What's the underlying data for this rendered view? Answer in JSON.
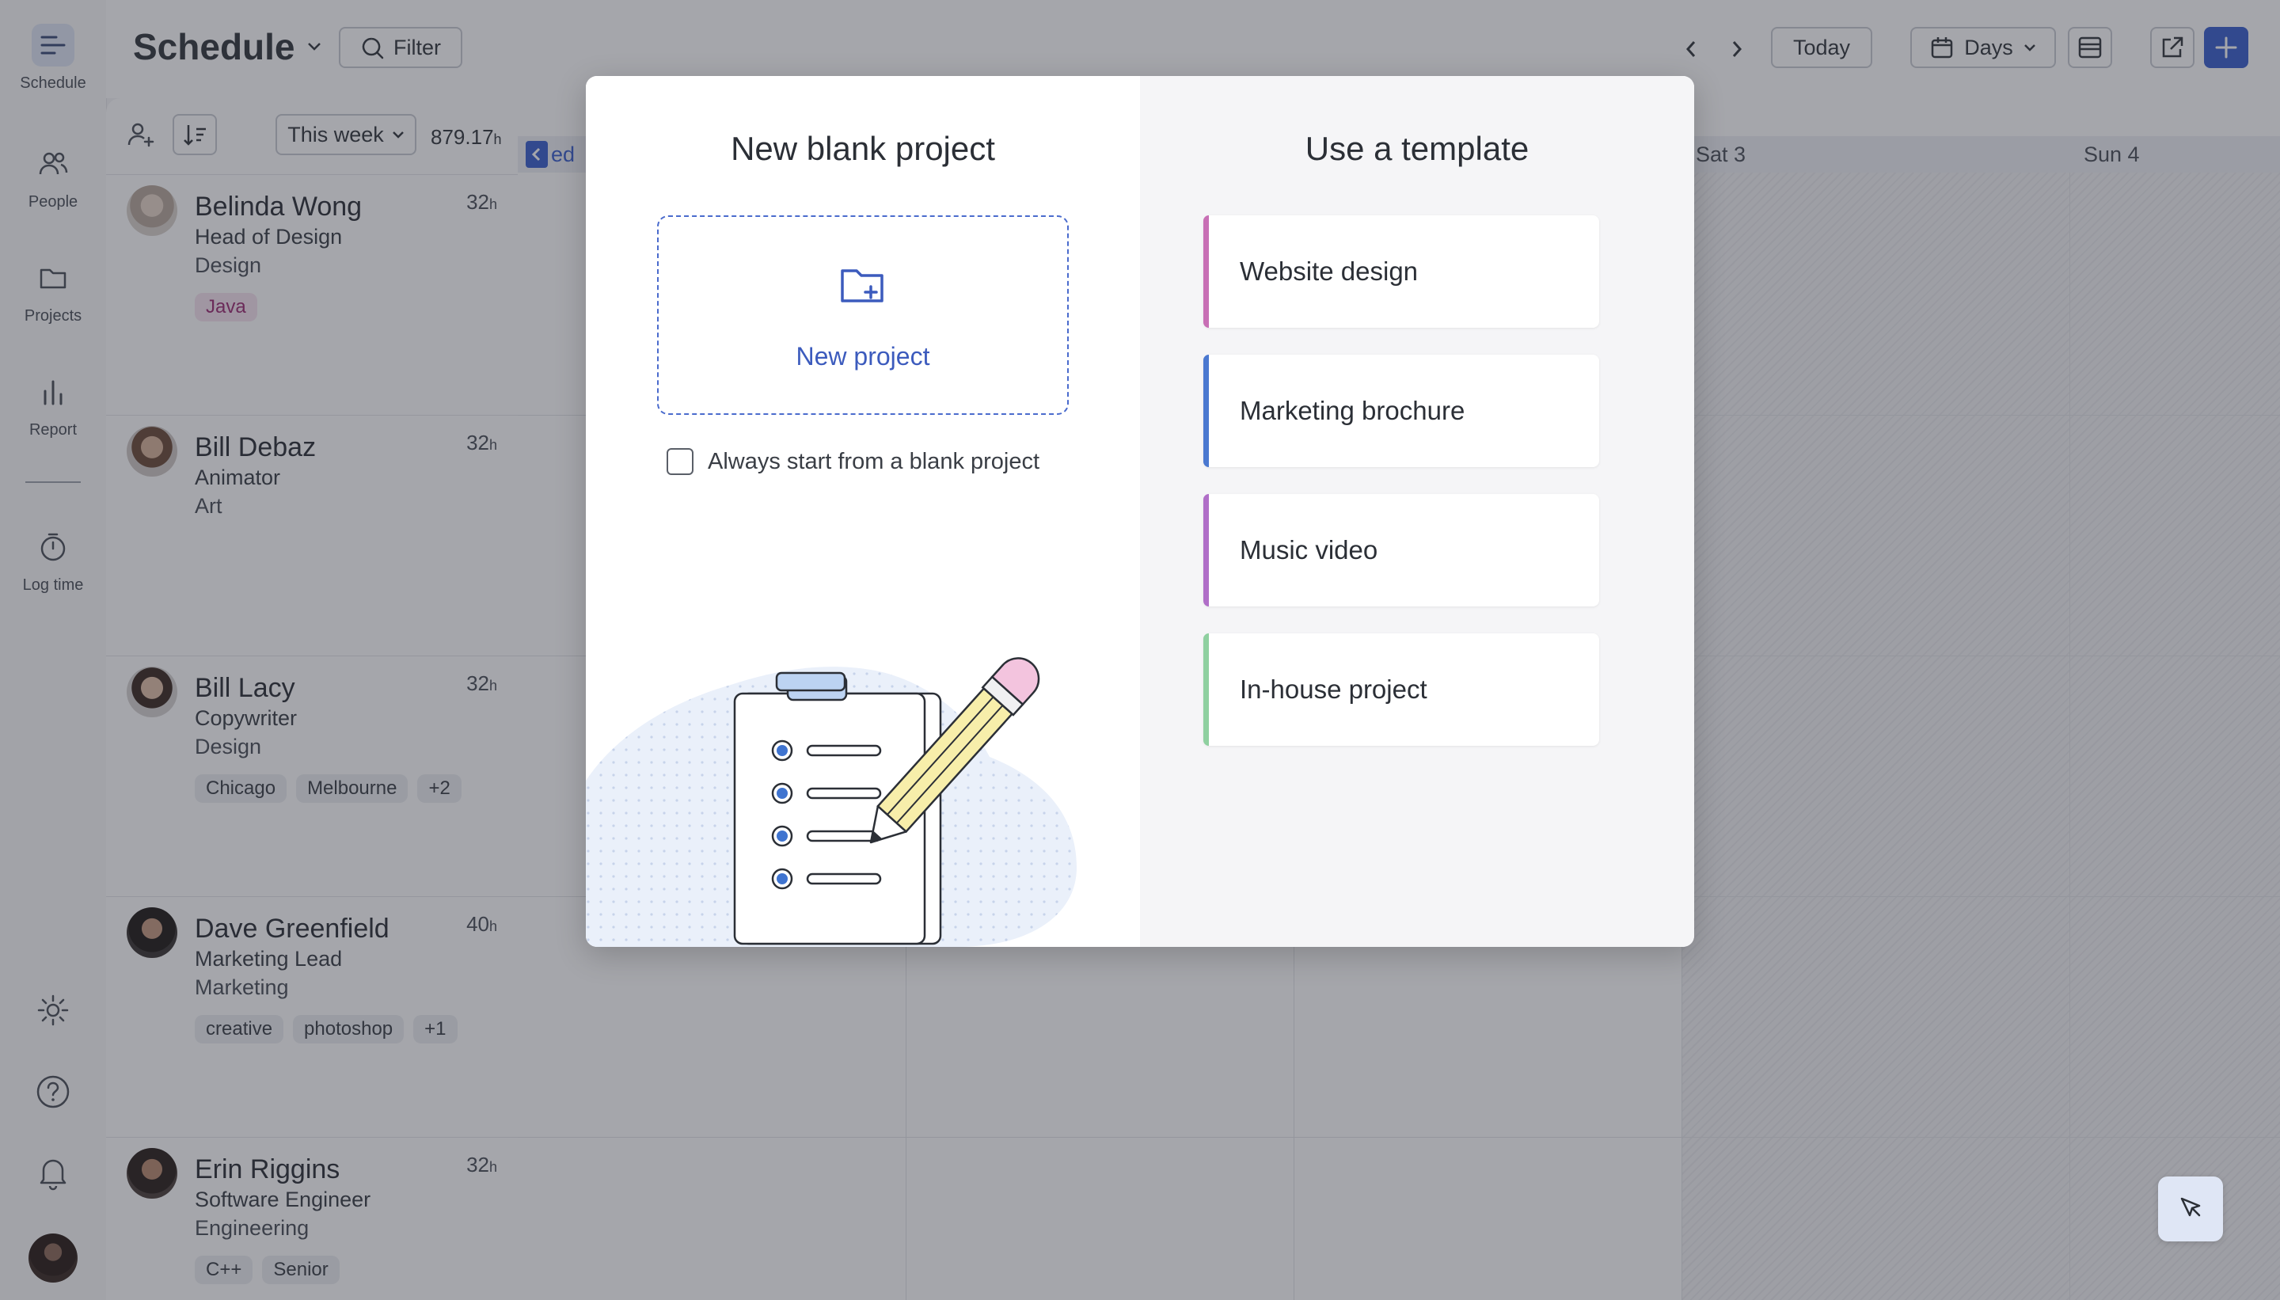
{
  "app": {
    "title": "Schedule",
    "filter_label": "Filter",
    "today_label": "Today",
    "view_label": "Days",
    "accent_color": "#3a5fcd"
  },
  "rail": {
    "items": [
      {
        "label": "Schedule",
        "icon": "schedule-icon"
      },
      {
        "label": "People",
        "icon": "people-icon"
      },
      {
        "label": "Projects",
        "icon": "folder-icon"
      },
      {
        "label": "Report",
        "icon": "bar-chart-icon"
      },
      {
        "label": "Log time",
        "icon": "timer-icon"
      }
    ]
  },
  "people_panel": {
    "range_label": "This week",
    "total_hours": "879.17",
    "hours_unit": "h"
  },
  "people": [
    {
      "name": "Belinda Wong",
      "role": "Head of Design",
      "dept": "Design",
      "hours": "32",
      "tags": [
        "Java"
      ]
    },
    {
      "name": "Bill Debaz",
      "role": "Animator",
      "dept": "Art",
      "hours": "32",
      "tags": []
    },
    {
      "name": "Bill Lacy",
      "role": "Copywriter",
      "dept": "Design",
      "hours": "32",
      "tags": [
        "Chicago",
        "Melbourne",
        "+2"
      ]
    },
    {
      "name": "Dave Greenfield",
      "role": "Marketing Lead",
      "dept": "Marketing",
      "hours": "40",
      "tags": [
        "creative",
        "photoshop",
        "+1"
      ]
    },
    {
      "name": "Erin Riggins",
      "role": "Software Engineer",
      "dept": "Engineering",
      "hours": "32",
      "tags": [
        "C++",
        "Senior"
      ]
    }
  ],
  "calendar": {
    "partial_day": "ed",
    "days": [
      "Sat 3",
      "Sun 4"
    ]
  },
  "modal": {
    "blank_title": "New blank project",
    "new_project_label": "New project",
    "always_blank_label": "Always start from a blank project",
    "always_blank_checked": false,
    "template_title": "Use a template",
    "templates": [
      {
        "label": "Website design",
        "color": "#c86fb5"
      },
      {
        "label": "Marketing brochure",
        "color": "#4a78d0"
      },
      {
        "label": "Music video",
        "color": "#b06ec8"
      },
      {
        "label": "In-house project",
        "color": "#8fd0a0"
      }
    ]
  }
}
